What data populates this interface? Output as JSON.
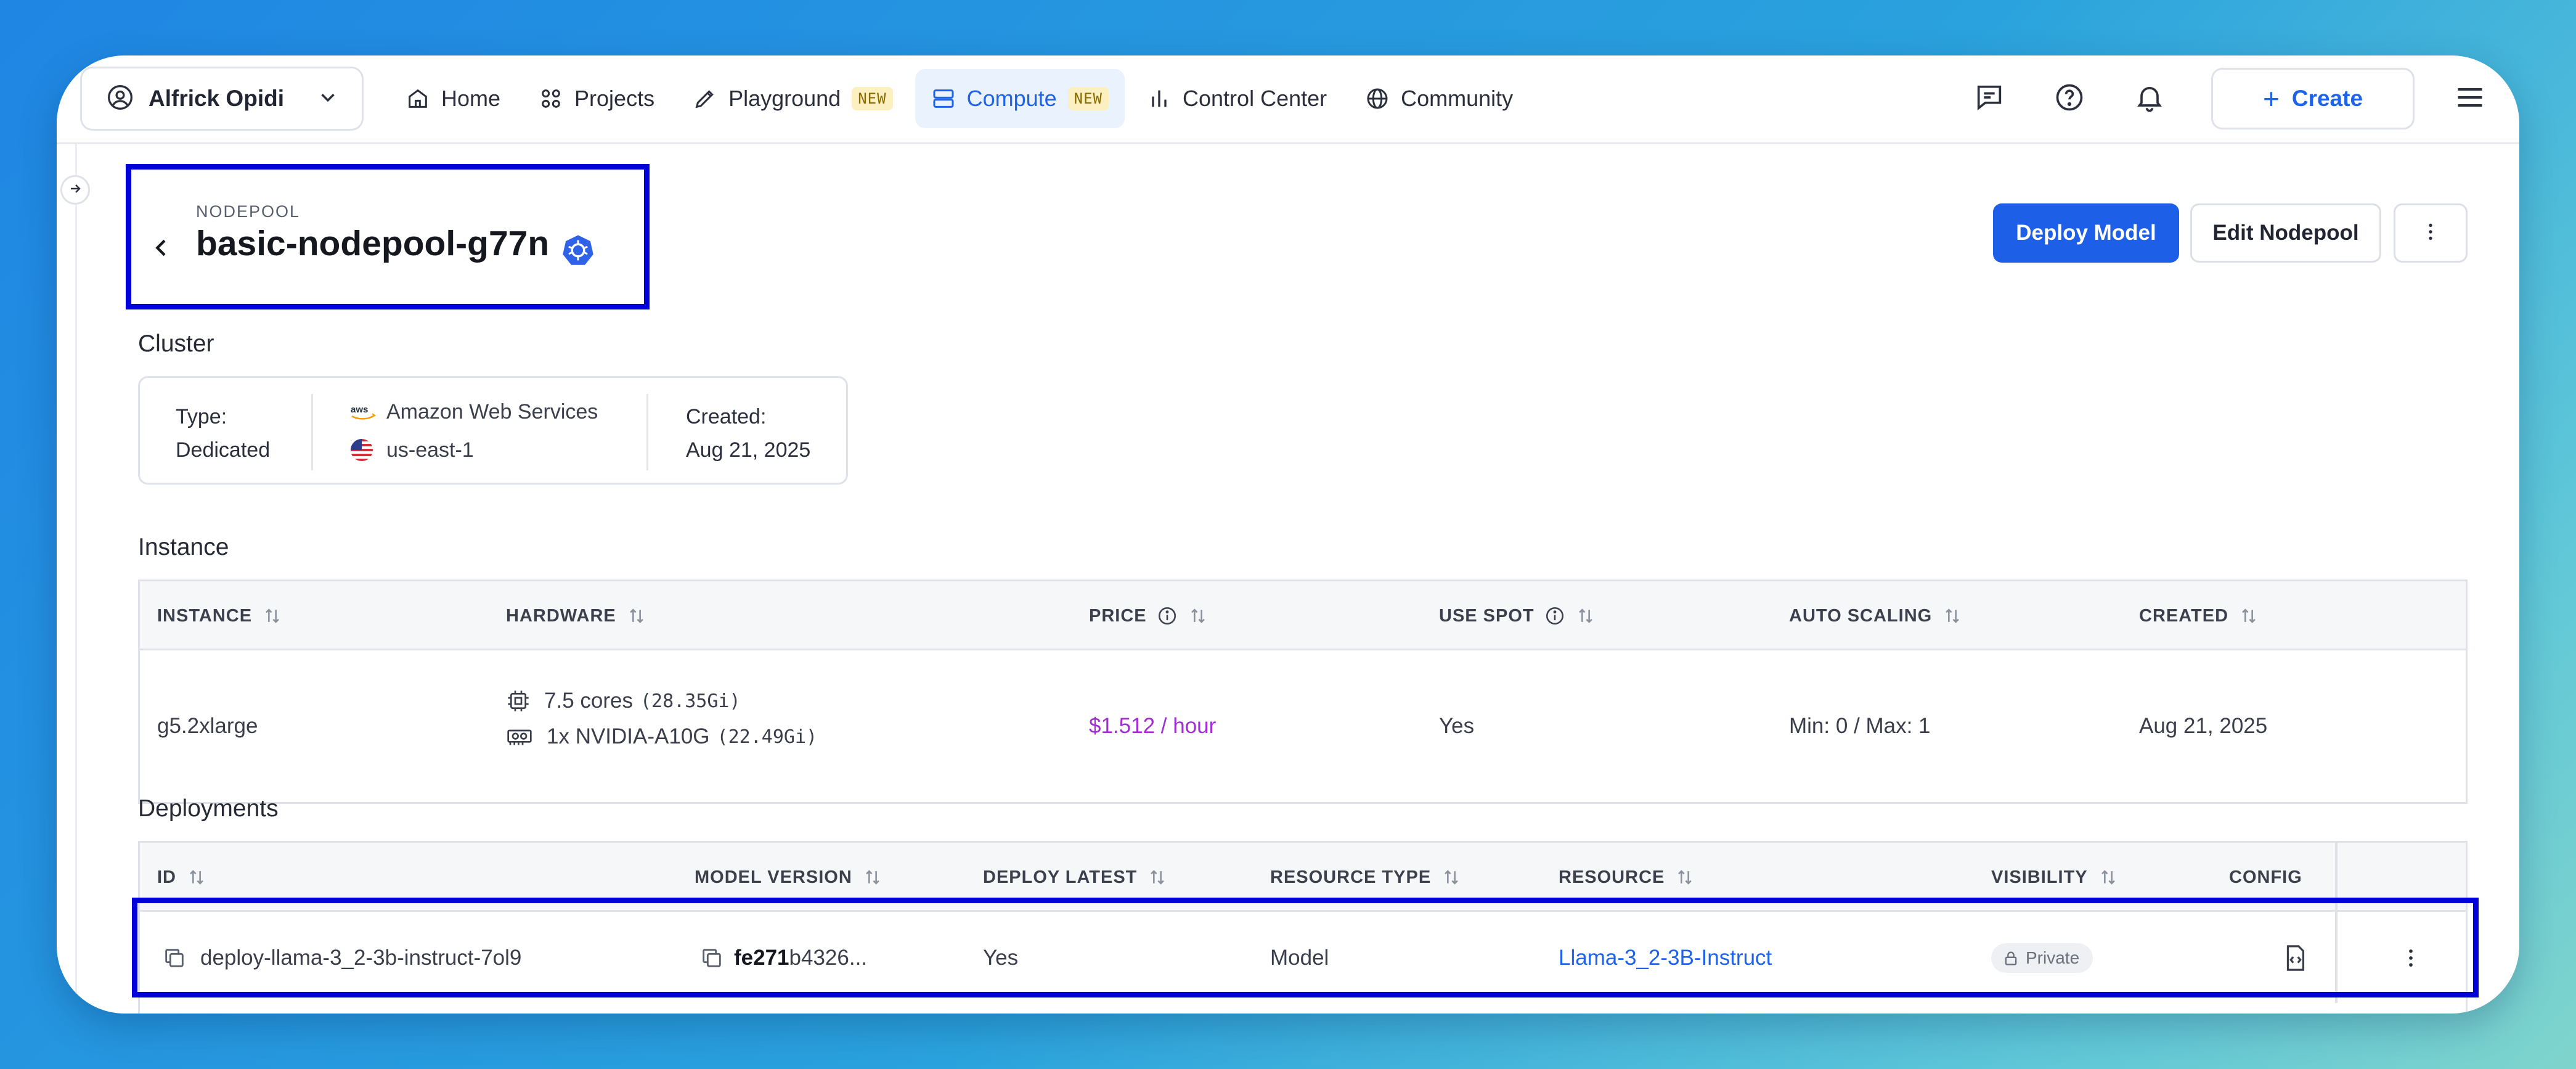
{
  "user": {
    "name": "Alfrick Opidi"
  },
  "nav": {
    "items": [
      {
        "label": "Home",
        "icon": "home-icon"
      },
      {
        "label": "Projects",
        "icon": "projects-icon"
      },
      {
        "label": "Playground",
        "icon": "playground-icon",
        "badge": "NEW"
      },
      {
        "label": "Compute",
        "icon": "compute-icon",
        "badge": "NEW",
        "active": true
      },
      {
        "label": "Control Center",
        "icon": "chart-icon"
      },
      {
        "label": "Community",
        "icon": "globe-icon"
      }
    ]
  },
  "toolbar": {
    "create_label": "Create"
  },
  "header": {
    "eyebrow": "NODEPOOL",
    "title": "basic-nodepool-g77n",
    "deploy_label": "Deploy Model",
    "edit_label": "Edit Nodepool"
  },
  "cluster": {
    "section": "Cluster",
    "type_label": "Type:",
    "type_value": "Dedicated",
    "provider": "Amazon Web Services",
    "region": "us-east-1",
    "created_label": "Created:",
    "created_value": "Aug 21, 2025"
  },
  "instance": {
    "section": "Instance",
    "columns": [
      "INSTANCE",
      "HARDWARE",
      "PRICE",
      "USE SPOT",
      "AUTO SCALING",
      "CREATED"
    ],
    "row": {
      "instance": "g5.2xlarge",
      "cpu": "7.5 cores",
      "cpu_mem": "(28.35Gi)",
      "gpu": "1x NVIDIA-A10G",
      "gpu_mem": "(22.49Gi)",
      "price": "$1.512 / hour",
      "use_spot": "Yes",
      "auto_scaling": "Min: 0 / Max: 1",
      "created": "Aug 21, 2025"
    }
  },
  "deployments": {
    "section": "Deployments",
    "columns": [
      "ID",
      "MODEL VERSION",
      "DEPLOY LATEST",
      "RESOURCE TYPE",
      "RESOURCE",
      "VISIBILITY",
      "CONFIG"
    ],
    "row": {
      "id": "deploy-llama-3_2-3b-instruct-7ol9",
      "version_bold": "fe271",
      "version_rest": "b4326...",
      "deploy_latest": "Yes",
      "resource_type": "Model",
      "resource": "Llama-3_2-3B-Instruct",
      "visibility": "Private"
    }
  },
  "colors": {
    "accent": "#1d5fe6",
    "price": "#a12ed2",
    "highlight": "#0000d8"
  }
}
